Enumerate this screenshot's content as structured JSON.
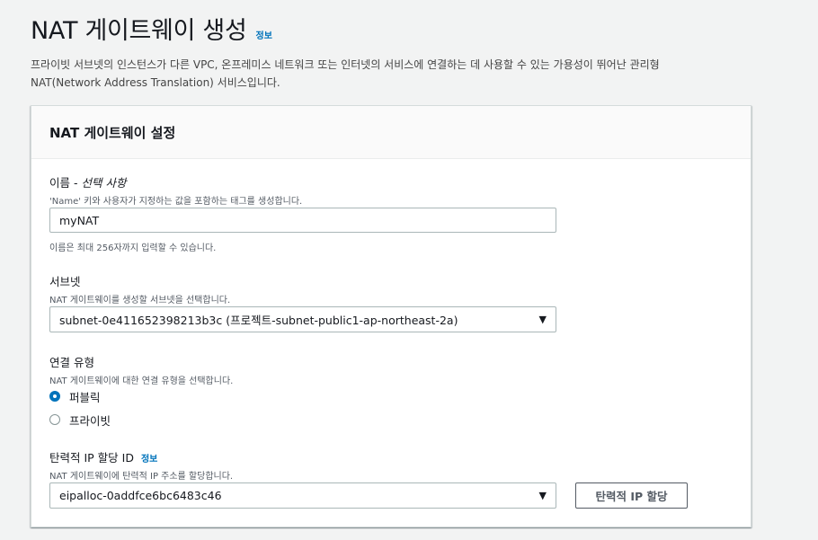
{
  "header": {
    "title": "NAT 게이트웨이 생성",
    "info": "정보",
    "description": "프라이빗 서브넷의 인스턴스가 다른 VPC, 온프레미스 네트워크 또는 인터넷의 서비스에 연결하는 데 사용할 수 있는 가용성이 뛰어난 관리형 NAT(Network Address Translation) 서비스입니다."
  },
  "panel": {
    "title": "NAT 게이트웨이 설정"
  },
  "name_field": {
    "label": "이름 -",
    "optional": "선택 사항",
    "description": "'Name' 키와 사용자가 지정하는 값을 포함하는 태그를 생성합니다.",
    "value": "myNAT",
    "hint": "이름은 최대 256자까지 입력할 수 있습니다."
  },
  "subnet_field": {
    "label": "서브넷",
    "description": "NAT 게이트웨이를 생성할 서브넷을 선택합니다.",
    "selected": "subnet-0e411652398213b3c (프로젝트-subnet-public1-ap-northeast-2a)"
  },
  "connectivity_field": {
    "label": "연결 유형",
    "description": "NAT 게이트웨이에 대한 연결 유형을 선택합니다.",
    "options": [
      {
        "label": "퍼블릭",
        "checked": true
      },
      {
        "label": "프라이빗",
        "checked": false
      }
    ]
  },
  "eip_field": {
    "label": "탄력적 IP 할당 ID",
    "info": "정보",
    "description": "NAT 게이트웨이에 탄력적 IP 주소를 할당합니다.",
    "selected": "eipalloc-0addfce6bc6483c46",
    "button_label": "탄력적 IP 할당"
  }
}
